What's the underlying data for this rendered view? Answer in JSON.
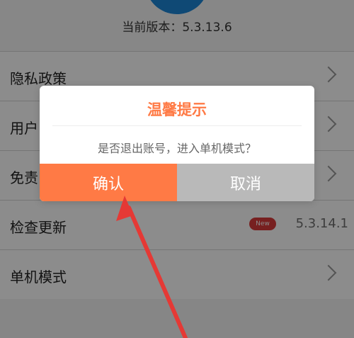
{
  "header": {
    "version_text": "当前版本：5.3.13.6"
  },
  "settings": {
    "items": [
      {
        "label": "隐私政策"
      },
      {
        "label": "用户"
      },
      {
        "label": "免责"
      },
      {
        "label": "检查更新",
        "badge": "New",
        "value": "5.3.14.1"
      },
      {
        "label": "单机模式"
      }
    ]
  },
  "dialog": {
    "title": "温馨提示",
    "message": "是否退出账号，进入单机模式？",
    "confirm_label": "确认",
    "cancel_label": "取消"
  },
  "colors": {
    "accent": "#ff7a45",
    "cancel_bg": "#b9b9b9",
    "badge_bg": "#d93b3b",
    "annotation_arrow": "#e53935"
  },
  "icons": {
    "chevron": "chevron-right-icon",
    "annotation": "arrow-annotation-icon"
  }
}
